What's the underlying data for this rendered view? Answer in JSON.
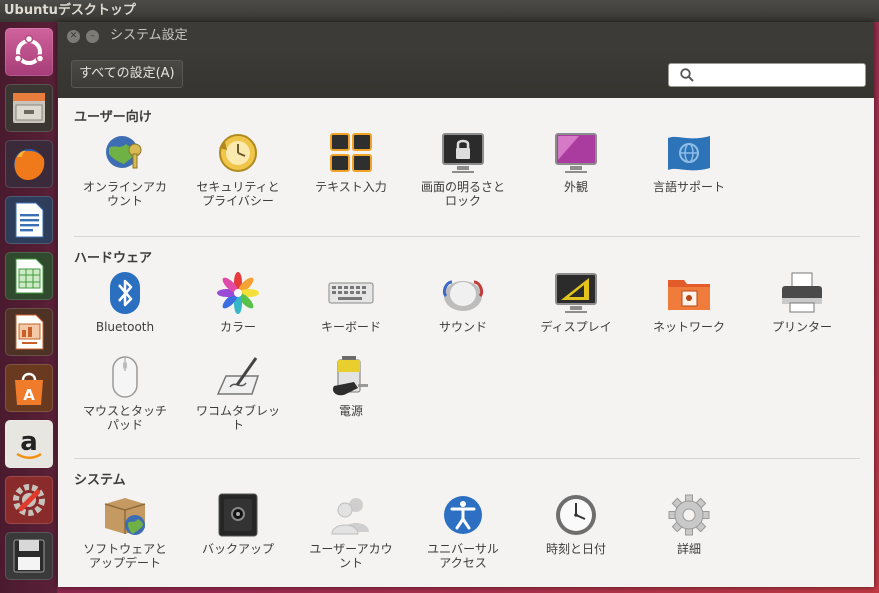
{
  "top_panel": {
    "title": "Ubuntuデスクトップ"
  },
  "launcher": {
    "items": [
      {
        "name": "dash-home"
      },
      {
        "name": "files"
      },
      {
        "name": "firefox"
      },
      {
        "name": "libreoffice-writer"
      },
      {
        "name": "libreoffice-calc"
      },
      {
        "name": "libreoffice-impress"
      },
      {
        "name": "ubuntu-software-center"
      },
      {
        "name": "amazon"
      },
      {
        "name": "system-settings"
      },
      {
        "name": "floppy-drive"
      }
    ]
  },
  "window": {
    "title": "システム設定",
    "all_settings_label": "すべての設定(A)",
    "search_placeholder": "",
    "sections": [
      {
        "title": "ユーザー向け",
        "items": [
          {
            "label": "オンラインアカ\nウント",
            "icon": "online-accounts-icon"
          },
          {
            "label": "セキュリティと\nプライバシー",
            "icon": "security-privacy-icon"
          },
          {
            "label": "テキスト入力",
            "icon": "text-entry-icon"
          },
          {
            "label": "画面の明るさと\nロック",
            "icon": "brightness-lock-icon"
          },
          {
            "label": "外観",
            "icon": "appearance-icon"
          },
          {
            "label": "言語サポート",
            "icon": "language-support-icon"
          }
        ]
      },
      {
        "title": "ハードウェア",
        "items": [
          {
            "label": "Bluetooth",
            "icon": "bluetooth-icon"
          },
          {
            "label": "カラー",
            "icon": "color-icon"
          },
          {
            "label": "キーボード",
            "icon": "keyboard-icon"
          },
          {
            "label": "サウンド",
            "icon": "sound-icon"
          },
          {
            "label": "ディスプレイ",
            "icon": "display-icon"
          },
          {
            "label": "ネットワーク",
            "icon": "network-icon"
          },
          {
            "label": "プリンター",
            "icon": "printer-icon"
          },
          {
            "label": "マウスとタッチ\nパッド",
            "icon": "mouse-touchpad-icon"
          },
          {
            "label": "ワコムタブレッ\nト",
            "icon": "wacom-tablet-icon"
          },
          {
            "label": "電源",
            "icon": "power-icon"
          }
        ]
      },
      {
        "title": "システム",
        "items": [
          {
            "label": "ソフトウェアと\nアップデート",
            "icon": "software-updates-icon"
          },
          {
            "label": "バックアップ",
            "icon": "backup-icon"
          },
          {
            "label": "ユーザーアカウ\nント",
            "icon": "user-accounts-icon"
          },
          {
            "label": "ユニバーサル\nアクセス",
            "icon": "universal-access-icon"
          },
          {
            "label": "時刻と日付",
            "icon": "time-date-icon"
          },
          {
            "label": "詳細",
            "icon": "details-icon"
          }
        ]
      }
    ]
  }
}
